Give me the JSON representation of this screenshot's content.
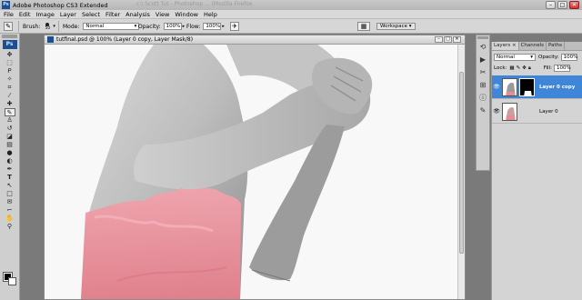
{
  "titlebar": {
    "title": "Adobe Photoshop CS3 Extended",
    "ghost": "c:\\ Scott Tut - Photoshop ... (Mozilla Firefox"
  },
  "menu": [
    "File",
    "Edit",
    "Image",
    "Layer",
    "Select",
    "Filter",
    "Analysis",
    "View",
    "Window",
    "Help"
  ],
  "options": {
    "brush_label": "Brush:",
    "brush_size": "50",
    "mode_label": "Mode:",
    "mode_value": "Normal",
    "opacity_label": "Opacity:",
    "opacity_value": "100%",
    "flow_label": "Flow:",
    "flow_value": "100%",
    "workspace_label": "Workspace ▾"
  },
  "document": {
    "title": "tutfinal.psd @ 100% (Layer 0 copy, Layer Mask/8)"
  },
  "layers_panel": {
    "tabs": [
      "Layers ×",
      "Channels",
      "Paths"
    ],
    "blend_mode": "Normal",
    "opacity_label": "Opacity:",
    "opacity_value": "100%",
    "lock_label": "Lock:",
    "fill_label": "Fill:",
    "fill_value": "100%",
    "layers": [
      {
        "name": "Layer 0 copy",
        "selected": true,
        "has_mask": true
      },
      {
        "name": "Layer 0",
        "selected": false,
        "has_mask": false
      }
    ]
  },
  "colors": {
    "selected_layer": "#3f86d8",
    "pink_mask": "#e98a95",
    "ps_blue": "#1f4e8c"
  },
  "icons": {
    "tools": [
      "move-icon",
      "marquee-icon",
      "lasso-icon",
      "quick-select-icon",
      "crop-icon",
      "slice-icon",
      "healing-icon",
      "brush-icon",
      "clone-stamp-icon",
      "history-brush-icon",
      "eraser-icon",
      "gradient-icon",
      "blur-icon",
      "dodge-icon",
      "pen-icon",
      "type-icon",
      "path-select-icon",
      "shape-icon",
      "notes-icon",
      "eyedropper-icon",
      "hand-icon",
      "zoom-icon"
    ],
    "dock": [
      "history-icon",
      "actions-icon",
      "tool-presets-icon",
      "navigator-icon",
      "info-icon",
      "brushes-icon"
    ]
  }
}
